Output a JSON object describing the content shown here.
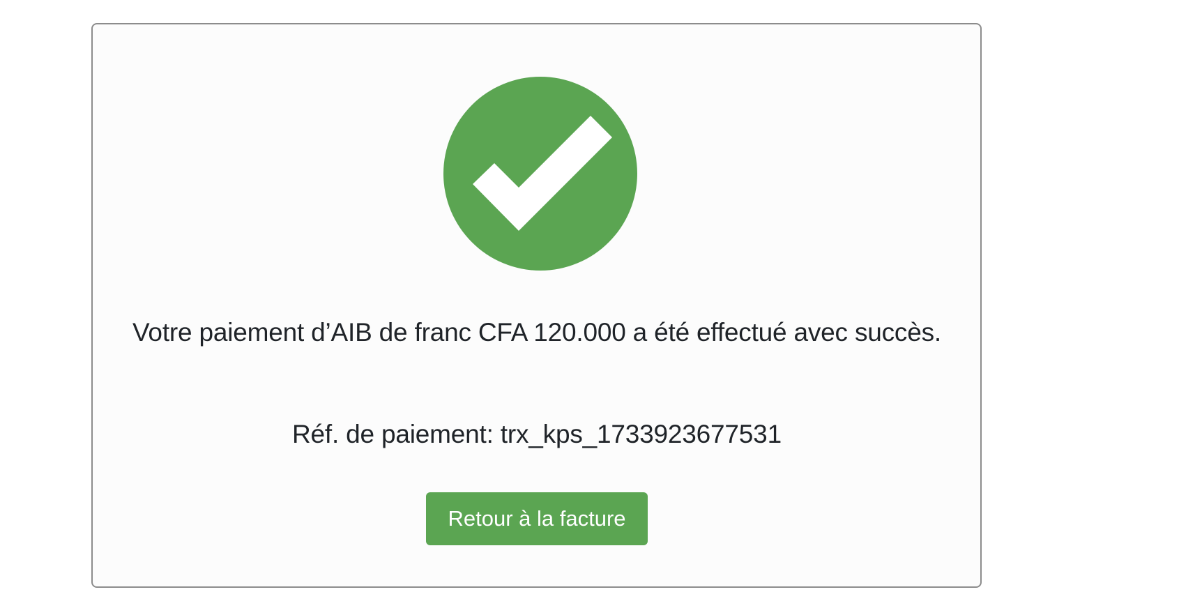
{
  "confirmation": {
    "message": "Votre paiement d’AIB de franc CFA 120.000 a été effectué avec succès.",
    "reference_label": "Réf. de paiement:",
    "reference_value": "trx_kps_1733923677531",
    "back_button_label": "Retour à la facture",
    "icon": "success-check-circle-icon"
  },
  "colors": {
    "success_green": "#5ba552",
    "card_border": "#8c8c8c",
    "text": "#1f2328"
  }
}
